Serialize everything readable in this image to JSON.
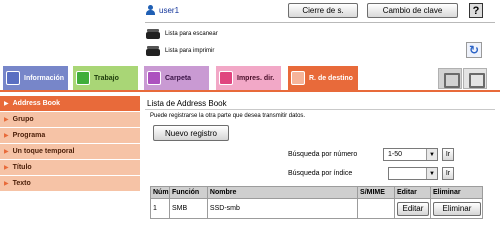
{
  "header": {
    "user_name": "user1",
    "logout_label": "Cierre de s.",
    "change_password_label": "Cambio de clave",
    "help_label": "?"
  },
  "status": {
    "scan_ready": "Lista para escanear",
    "print_ready": "Lista para imprimir"
  },
  "tabs": [
    {
      "label": "Información",
      "icon": "info-icon"
    },
    {
      "label": "Trabajo",
      "icon": "job-icon"
    },
    {
      "label": "Carpeta",
      "icon": "folder-icon"
    },
    {
      "label": "Impres. dir.",
      "icon": "print-icon"
    },
    {
      "label": "R. de destino",
      "icon": "destination-icon"
    }
  ],
  "sidebar": {
    "items": [
      {
        "label": "Address Book",
        "active": true
      },
      {
        "label": "Grupo"
      },
      {
        "label": "Programa"
      },
      {
        "label": "Un toque temporal"
      },
      {
        "label": "Título"
      },
      {
        "label": "Texto"
      }
    ]
  },
  "main": {
    "title": "Lista de Address Book",
    "description": "Puede registrarse la otra parte que desea transmitir datos.",
    "new_button": "Nuevo registro",
    "search_by_number_label": "Búsqueda por número",
    "search_by_number_value": "1-50",
    "search_by_index_label": "Búsqueda por índice",
    "search_by_index_value": "",
    "go_label": "Ir"
  },
  "table": {
    "headers": [
      "Núm",
      "Función",
      "Nombre",
      "S/MIME",
      "Editar",
      "Eliminar"
    ],
    "rows": [
      {
        "num": "1",
        "func": "SMB",
        "name": "SSD-smb",
        "smime": "",
        "edit": "Editar",
        "delete": "Eliminar"
      }
    ]
  },
  "colors": {
    "accent": "#e86a3a",
    "sidebar_bg": "#f6c3a6"
  }
}
